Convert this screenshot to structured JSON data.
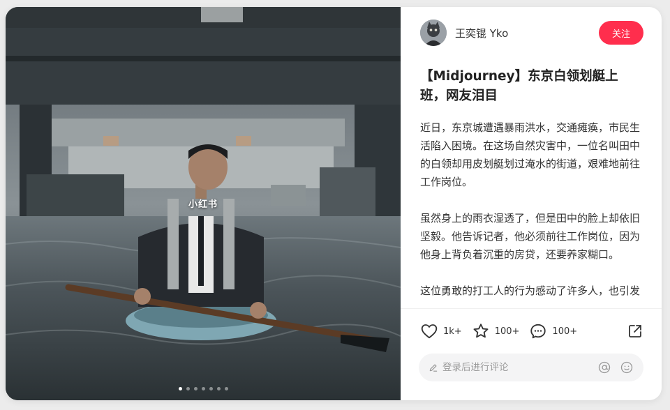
{
  "post": {
    "author_name": "王奕锟 Yko",
    "follow_label": "关注",
    "title": "【Midjourney】东京白领划艇上班，网友泪目",
    "paragraphs": [
      "近日，东京城遭遇暴雨洪水，交通瘫痪，市民生活陷入困境。在这场自然灾害中，一位名叫田中的白领却用皮划艇划过淹水的街道，艰难地前往工作岗位。",
      "虽然身上的雨衣湿透了，但是田中的脸上却依旧坚毅。他告诉记者，他必须前往工作岗位，因为他身上背负着沉重的房贷，还要养家糊口。",
      "这位勇敢的打工人的行为感动了许多人，也引发"
    ]
  },
  "media": {
    "watermark": "小红书",
    "page_count": 7,
    "current_page": 1
  },
  "actions": {
    "like_count": "1k+",
    "collect_count": "100+",
    "comment_count": "100+"
  },
  "comment_box": {
    "placeholder": "登录后进行评论"
  },
  "colors": {
    "accent": "#ff2e4d"
  },
  "icons": [
    "heart-icon",
    "star-icon",
    "comment-bubble-icon",
    "share-icon",
    "pencil-icon",
    "at-icon",
    "emoji-icon"
  ]
}
